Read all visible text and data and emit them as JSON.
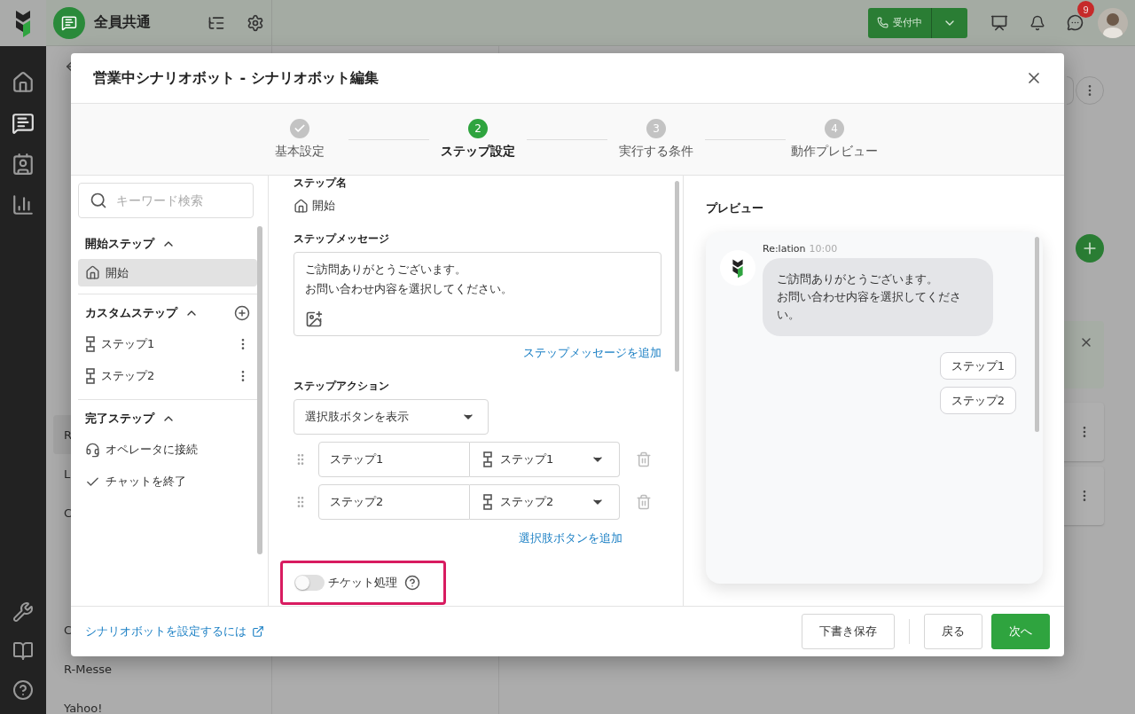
{
  "topbar": {
    "workspace": "全員共通",
    "status_button": "受付中",
    "notification_count": "9"
  },
  "background_list": [
    {
      "kind": "header",
      "selected": false
    },
    {
      "kind": "item",
      "selected": false
    },
    {
      "kind": "item",
      "selected": false
    },
    {
      "kind": "item",
      "selected": false
    },
    {
      "kind": "item",
      "selected": false
    },
    {
      "kind": "item",
      "selected": false
    },
    {
      "kind": "header",
      "selected": false
    },
    {
      "kind": "item",
      "selected": false
    },
    {
      "label": "R",
      "kind": "item",
      "selected": true
    },
    {
      "label": "L",
      "kind": "item",
      "selected": false
    },
    {
      "label": "C",
      "kind": "item",
      "selected": false
    },
    {
      "kind": "item",
      "selected": false
    },
    {
      "kind": "item",
      "selected": false
    },
    {
      "label": "C",
      "kind": "item",
      "selected": false
    },
    {
      "label": "R-Messe",
      "kind": "item",
      "selected": false
    },
    {
      "label": "Yahoo!",
      "kind": "item",
      "selected": false
    }
  ],
  "modal": {
    "title": "営業中シナリオボット - シナリオボット編集",
    "steps": [
      {
        "label": "基本設定",
        "completed": true,
        "current": false
      },
      {
        "number": "2",
        "label": "ステップ設定",
        "completed": false,
        "current": true
      },
      {
        "number": "3",
        "label": "実行する条件",
        "completed": false,
        "current": false
      },
      {
        "number": "4",
        "label": "動作プレビュー",
        "completed": false,
        "current": false
      }
    ],
    "sidebar": {
      "search_placeholder": "キーワード検索",
      "sections": [
        {
          "title": "開始ステップ",
          "kind": "start",
          "expanded": true,
          "items": [
            {
              "label": "開始",
              "kind": "home",
              "selected": true
            }
          ]
        },
        {
          "title": "カスタムステップ",
          "kind": "custom",
          "expanded": true,
          "items": [
            {
              "label": "ステップ1",
              "kind": "step",
              "selected": false
            },
            {
              "label": "ステップ2",
              "kind": "step",
              "selected": false
            }
          ]
        },
        {
          "title": "完了ステップ",
          "kind": "end",
          "expanded": true,
          "items": [
            {
              "label": "オペレータに接続",
              "kind": "operator",
              "selected": false
            },
            {
              "label": "チャットを終了",
              "kind": "finish",
              "selected": false
            }
          ]
        }
      ]
    },
    "editor": {
      "step_name_label": "ステップ名",
      "step_name": "開始",
      "message_label": "ステップメッセージ",
      "message_lines": [
        "ご訪問ありがとうございます。",
        "お問い合わせ内容を選択してください。"
      ],
      "add_message_link": "ステップメッセージを追加",
      "action_label": "ステップアクション",
      "action_select": "選択肢ボタンを表示",
      "choices": [
        {
          "label": "ステップ1",
          "target": "ステップ1"
        },
        {
          "label": "ステップ2",
          "target": "ステップ2"
        }
      ],
      "add_choice_link": "選択肢ボタンを追加",
      "ticket": {
        "label": "チケット処理",
        "on": false
      }
    },
    "preview": {
      "title": "プレビュー",
      "sender": "Re:lation",
      "time": "10:00",
      "message_lines": [
        "ご訪問ありがとうございます。",
        "お問い合わせ内容を選択してください。"
      ],
      "choices": [
        "ステップ1",
        "ステップ2"
      ]
    },
    "footer": {
      "help_link": "シナリオボットを設定するには",
      "buttons": [
        {
          "label": "下書き保存",
          "kind": "secondary"
        },
        {
          "label": "戻る",
          "kind": "secondary"
        },
        {
          "label": "次へ",
          "kind": "primary"
        }
      ]
    }
  }
}
